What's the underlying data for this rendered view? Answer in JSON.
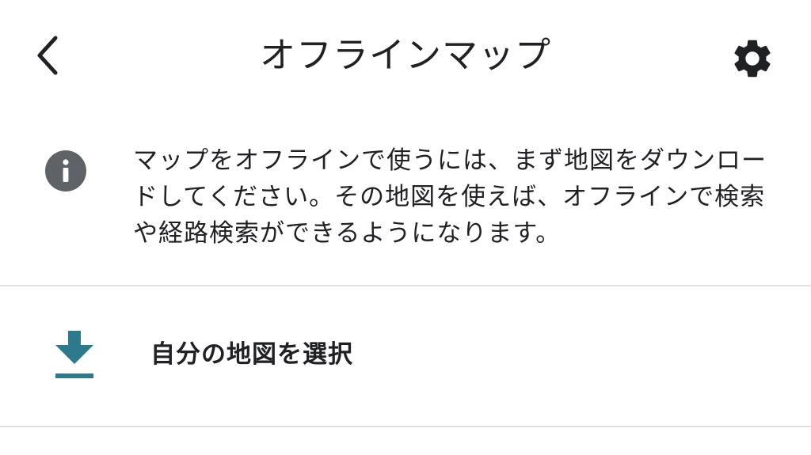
{
  "header": {
    "title": "オフラインマップ",
    "back_icon": "chevron-left-icon",
    "settings_icon": "gear-icon"
  },
  "info": {
    "icon": "info-icon",
    "text": "マップをオフラインで使うには、まず地図をダウンロードしてください。その地図を使えば、オフラインで検索や経路検索ができるようになります。"
  },
  "actions": {
    "select_map": {
      "label": "自分の地図を選択",
      "icon": "download-icon",
      "icon_color": "#2c7a8c"
    }
  }
}
